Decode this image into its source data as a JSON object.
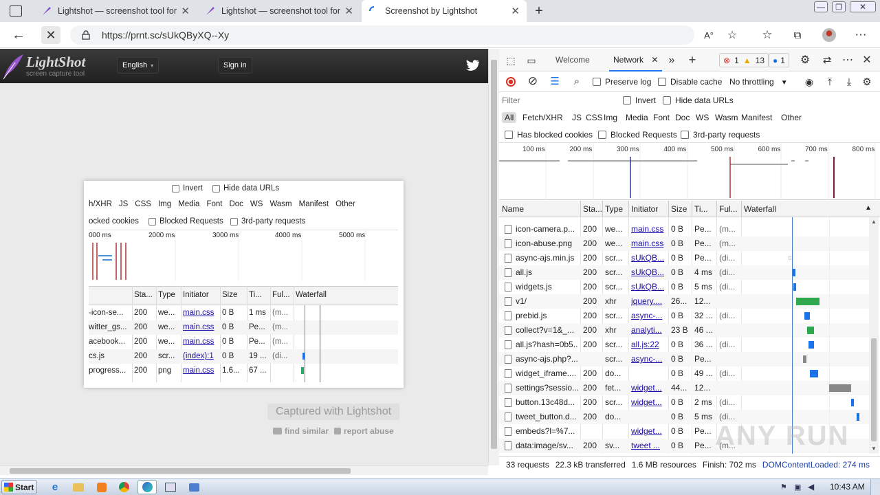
{
  "browser": {
    "tabs": [
      {
        "label": "Lightshot — screenshot tool for M",
        "close": "✕"
      },
      {
        "label": "Lightshot — screenshot tool for M",
        "close": "✕"
      },
      {
        "label": "Screenshot by Lightshot",
        "close": "✕"
      }
    ],
    "new_tab": "+",
    "url": "https://prnt.sc/sUkQByXQ--Xy"
  },
  "lightshot": {
    "logo": "LightShot",
    "tagline": "screen capture tool",
    "language": "English",
    "signin": "Sign in",
    "captured": "Captured with Lightshot",
    "find_similar": "find similar",
    "report_abuse": "report abuse"
  },
  "shot": {
    "invert": "Invert",
    "hide_data": "Hide data URLs",
    "filters": [
      "h/XHR",
      "JS",
      "CSS",
      "Img",
      "Media",
      "Font",
      "Doc",
      "WS",
      "Wasm",
      "Manifest",
      "Other"
    ],
    "cookies": "ocked cookies",
    "blocked_req": "Blocked Requests",
    "third_party": "3rd-party requests",
    "ticks": [
      "000 ms",
      "2000 ms",
      "3000 ms",
      "4000 ms",
      "5000 ms"
    ],
    "headers": [
      "Sta...",
      "Type",
      "Initiator",
      "Size",
      "Ti...",
      "Ful...",
      "Waterfall"
    ],
    "rows": [
      [
        "-icon-se...",
        "200",
        "we...",
        "main.css",
        "0 B",
        "1 ms",
        "(m..."
      ],
      [
        "witter_gs...",
        "200",
        "we...",
        "main.css",
        "0 B",
        "Pe...",
        "(m..."
      ],
      [
        "acebook...",
        "200",
        "we...",
        "main.css",
        "0 B",
        "Pe...",
        "(m..."
      ],
      [
        "cs.js",
        "200",
        "scr...",
        "(index):1",
        "0 B",
        "19 ...",
        "(di..."
      ],
      [
        "progress...",
        "200",
        "png",
        "main.css",
        "1.6...",
        "67 ...",
        ""
      ]
    ]
  },
  "devtools": {
    "tabs": [
      "Welcome",
      "Network"
    ],
    "errors": "1",
    "warnings": "13",
    "info": "1",
    "preserve_log": "Preserve log",
    "disable_cache": "Disable cache",
    "throttling": "No throttling",
    "filter_placeholder": "Filter",
    "invert": "Invert",
    "hide_data": "Hide data URLs",
    "types": [
      "All",
      "Fetch/XHR",
      "JS",
      "CSS",
      "Img",
      "Media",
      "Font",
      "Doc",
      "WS",
      "Wasm",
      "Manifest",
      "Other"
    ],
    "has_blocked": "Has blocked cookies",
    "blocked_req": "Blocked Requests",
    "third_party": "3rd-party requests",
    "ticks": [
      "100 ms",
      "200 ms",
      "300 ms",
      "400 ms",
      "500 ms",
      "600 ms",
      "700 ms",
      "800 ms"
    ],
    "headers": [
      "Name",
      "Sta...",
      "Type",
      "Initiator",
      "Size",
      "Ti...",
      "Ful...",
      "Waterfall"
    ],
    "rows": [
      [
        "icon-camera.p...",
        "200",
        "we...",
        "main.css",
        "0 B",
        "Pe...",
        "(m..."
      ],
      [
        "icon-abuse.png",
        "200",
        "we...",
        "main.css",
        "0 B",
        "Pe...",
        "(m..."
      ],
      [
        "async-ajs.min.js",
        "200",
        "scr...",
        "sUkQB...",
        "0 B",
        "Pe...",
        "(di..."
      ],
      [
        "all.js",
        "200",
        "scr...",
        "sUkQB...",
        "0 B",
        "4 ms",
        "(di..."
      ],
      [
        "widgets.js",
        "200",
        "scr...",
        "sUkQB...",
        "0 B",
        "5 ms",
        "(di..."
      ],
      [
        "v1/",
        "200",
        "xhr",
        "jquery....",
        "26...",
        "12...",
        ""
      ],
      [
        "prebid.js",
        "200",
        "scr...",
        "async-...",
        "0 B",
        "32 ...",
        "(di..."
      ],
      [
        "collect?v=1&_...",
        "200",
        "xhr",
        "analyti...",
        "23 B",
        "46 ...",
        ""
      ],
      [
        "all.js?hash=0b5...",
        "200",
        "scr...",
        "all.js:22",
        "0 B",
        "36 ...",
        "(di..."
      ],
      [
        "async-ajs.php?...",
        "",
        "scr...",
        "async-...",
        "0 B",
        "Pe...",
        ""
      ],
      [
        "widget_iframe....",
        "200",
        "do...",
        "",
        "0 B",
        "49 ...",
        "(di..."
      ],
      [
        "settings?sessio...",
        "200",
        "fet...",
        "widget...",
        "44...",
        "12...",
        ""
      ],
      [
        "button.13c48d...",
        "200",
        "scr...",
        "widget...",
        "0 B",
        "2 ms",
        "(di..."
      ],
      [
        "tweet_button.d...",
        "200",
        "do...",
        "",
        "0 B",
        "5 ms",
        "(di..."
      ],
      [
        "embeds?l=%7...",
        "",
        "",
        "widget...",
        "0 B",
        "Pe...",
        ""
      ],
      [
        "data:image/sv...",
        "200",
        "sv...",
        "tweet ...",
        "0 B",
        "Pe...",
        "(m..."
      ]
    ],
    "status": {
      "requests": "33 requests",
      "transferred": "22.3 kB transferred",
      "resources": "1.6 MB resources",
      "finish": "Finish: 702 ms",
      "dcl": "DOMContentLoaded: 274 ms"
    }
  },
  "taskbar": {
    "start": "Start",
    "time": "10:43 AM"
  },
  "watermark": "ANY RUN"
}
